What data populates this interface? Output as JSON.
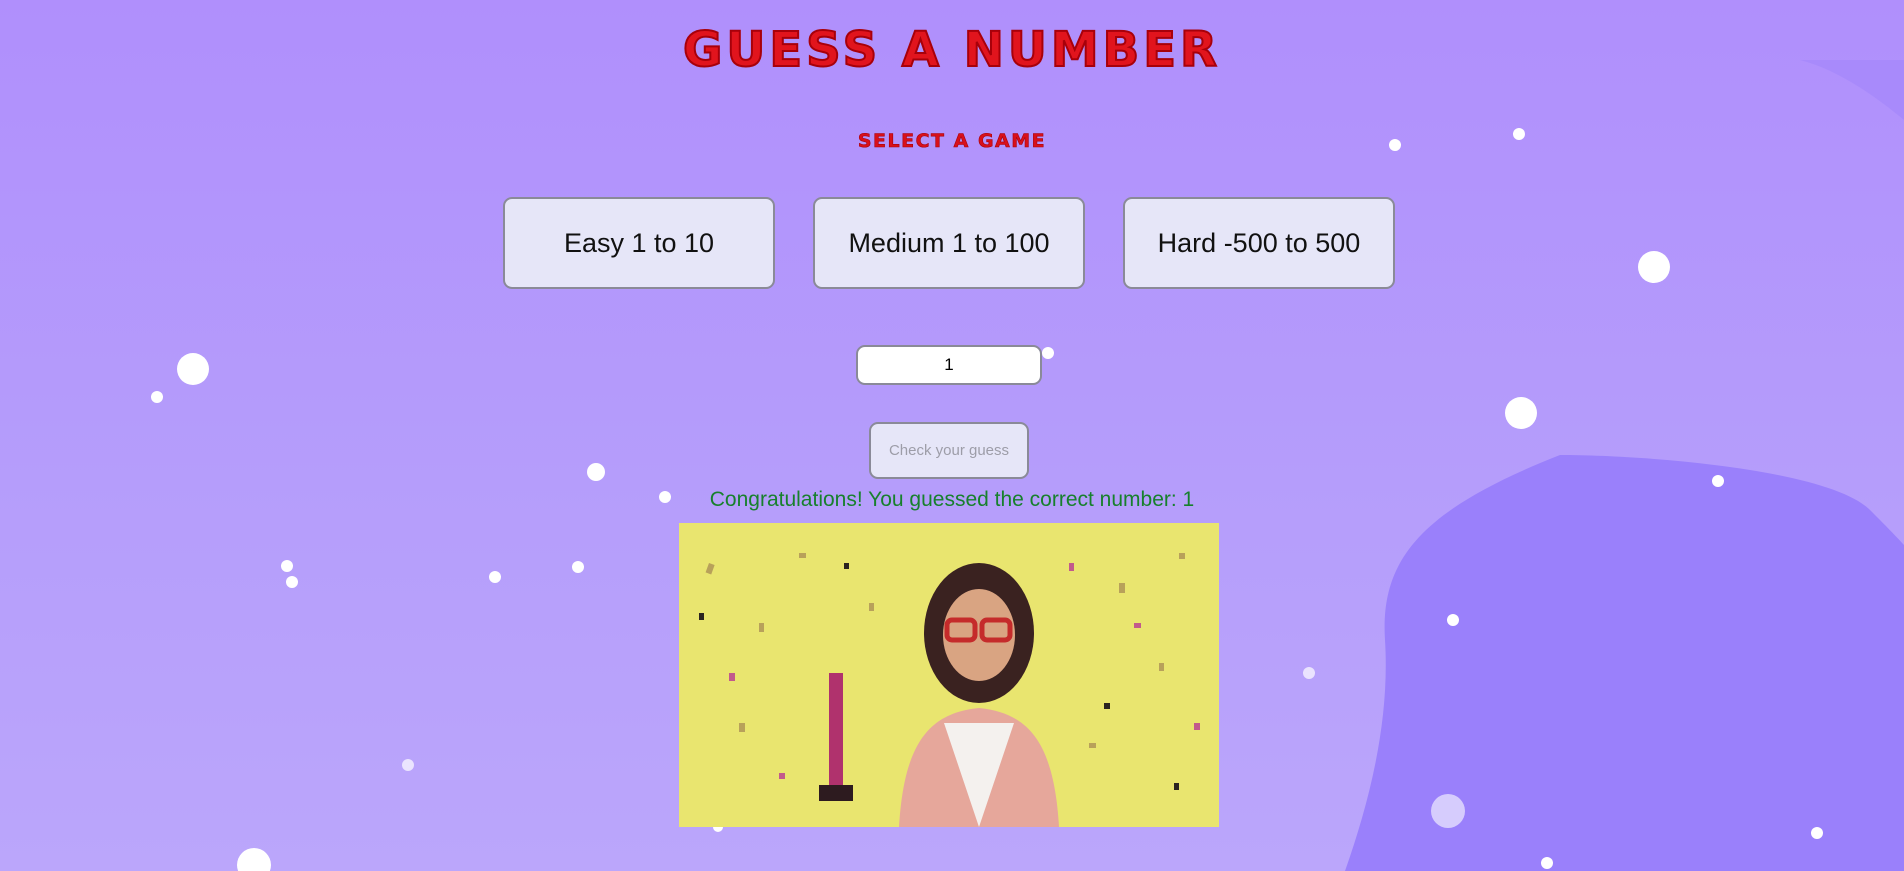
{
  "header": {
    "title": "GUESS A NUMBER",
    "subtitle": "SELECT A GAME"
  },
  "games": [
    {
      "label": "Easy 1 to 10"
    },
    {
      "label": "Medium 1 to 100"
    },
    {
      "label": "Hard -500 to 500"
    }
  ],
  "guess": {
    "value": "1"
  },
  "check_button": {
    "label": "Check your guess"
  },
  "result": {
    "message": "Congratulations! You guessed the correct number: 1"
  },
  "colors": {
    "background": "#b08ffc",
    "title": "#e1141d",
    "message": "#17802c",
    "button_fill": "#e6e6f8",
    "blob": "#9a80fb"
  }
}
